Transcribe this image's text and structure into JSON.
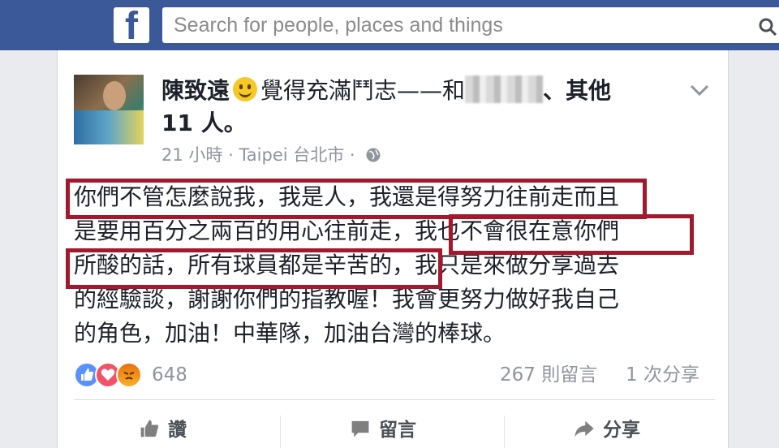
{
  "topbar": {
    "logo": "f",
    "search_placeholder": "Search for people, places and things"
  },
  "post": {
    "author": "陳致遠",
    "activity": "覺得充滿鬥志——和",
    "others": "、其他",
    "others_count": "11 人。",
    "time": "21 小時",
    "location": "· Taipei 台北市 ·",
    "lines": [
      "你們不管怎麼說我，我是人，我還是得努力往前走而且",
      "是要用百分之兩百的用心往前走，我也不會很在意你們",
      "所酸的話，所有球員都是辛苦的，我只是來做分享過去",
      "的經驗談，謝謝你們的指教喔！我會更努力做好我自己",
      "的角色，加油！中華隊，加油台灣的棒球。"
    ],
    "reaction_count": "648",
    "comments": "267 則留言",
    "shares": "1 次分享"
  },
  "actions": {
    "like": "讚",
    "comment": "留言",
    "share": "分享"
  },
  "colors": {
    "brand": "#3b5998",
    "highlight": "#a3182c"
  }
}
